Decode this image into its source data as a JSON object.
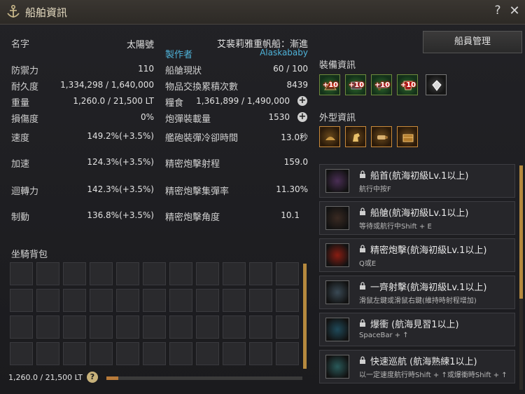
{
  "window": {
    "title": "船舶資訊",
    "help": "?",
    "close": "✕"
  },
  "ship": {
    "name_label": "名字",
    "name_value": "太陽號",
    "type": "艾裴莉雅重帆船：漸進",
    "creator_label": "製作者",
    "creator_value": "Alaskababy"
  },
  "stats_left": [
    {
      "label": "防禦力",
      "value": "110"
    },
    {
      "label": "耐久度",
      "value": "1,334,298 / 1,640,000"
    },
    {
      "label": "重量",
      "value": "1,260.0 / 21,500 LT"
    },
    {
      "label": "損傷度",
      "value": "0%"
    },
    {
      "label": "速度",
      "value": "149.2%(+3.5%)"
    },
    {
      "label": "加速",
      "value": "124.3%(+3.5%)"
    },
    {
      "label": "迴轉力",
      "value": "142.3%(+3.5%)"
    },
    {
      "label": "制動",
      "value": "136.8%(+3.5%)"
    }
  ],
  "stats_right": [
    {
      "label": "船艙現狀",
      "value": "60 / 100"
    },
    {
      "label": "物品交換累積次數",
      "value": "8439"
    },
    {
      "label": "糧食",
      "value": "1,361,899 / 1,490,000"
    },
    {
      "label": "炮彈裝載量",
      "value": "1530"
    },
    {
      "label": "艦砲裝彈冷卻時間",
      "value": "13.0秒"
    },
    {
      "label": "精密炮擊射程",
      "value": "159.0"
    },
    {
      "label": "精密炮擊集彈率",
      "value": "11.30%"
    },
    {
      "label": "精密炮擊角度",
      "value": "10.1"
    }
  ],
  "crew_button": "船員管理",
  "equipment": {
    "title": "裝備資訊",
    "slots": [
      {
        "icon": "ship-prow-icon",
        "badge": "+10"
      },
      {
        "icon": "ship-plating-icon",
        "badge": "+10"
      },
      {
        "icon": "ship-cannon-icon",
        "badge": "+10"
      },
      {
        "icon": "ship-sail-icon",
        "badge": "+10"
      },
      {
        "icon": "crystal-icon",
        "badge": ""
      }
    ]
  },
  "appearance": {
    "title": "外型資訊",
    "slots": [
      {
        "icon": "figurehead-icon"
      },
      {
        "icon": "horse-figure-icon"
      },
      {
        "icon": "cannon-skin-icon"
      },
      {
        "icon": "chest-icon"
      }
    ]
  },
  "inventory": {
    "title": "坐騎背包",
    "weight": "1,260.0 / 21,500 LT",
    "weight_help": "?",
    "weight_fill": 0.059
  },
  "skills": [
    {
      "icon": "prow-ram-icon",
      "name": "船首(航海初級Lv.1以上)",
      "desc": "航行中按F"
    },
    {
      "icon": "cabin-icon",
      "name": "船艙(航海初級Lv.1以上)",
      "desc": "等待或航行中Shift + E"
    },
    {
      "icon": "target-icon",
      "name": "精密炮擊(航海初級Lv.1以上)",
      "desc": "Q或E"
    },
    {
      "icon": "broadside-icon",
      "name": "一齊射擊(航海初級Lv.1以上)",
      "desc": "滑鼠左鍵或滑鼠右鍵(維持時射程增加)"
    },
    {
      "icon": "boost-icon",
      "name": "爆衝 (航海見習1以上)",
      "desc": "SpaceBar + ↑"
    },
    {
      "icon": "wave-icon",
      "name": "快速巡航 (航海熟練1以上)",
      "desc": "以一定速度航行時Shift + ↑或爆衝時Shift + ↑"
    }
  ],
  "colors": {
    "accent_gold": "#b5893e",
    "creator_blue": "#4fb3d9"
  }
}
